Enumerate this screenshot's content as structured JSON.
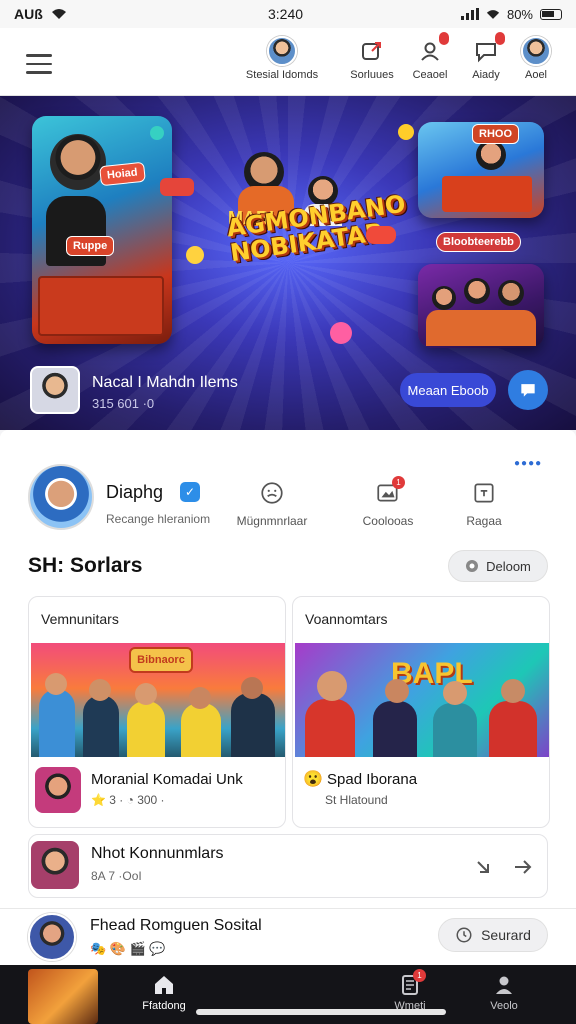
{
  "status_bar": {
    "carrier": "AUß",
    "time": "3:240",
    "battery": "80%"
  },
  "header": {
    "items": [
      {
        "label": "Stesial Idomds",
        "icon": "avatar"
      },
      {
        "label": "Sorluues",
        "icon": "share-icon"
      },
      {
        "label": "Ceaoel",
        "icon": "user-add-icon",
        "badge": ""
      },
      {
        "label": "Aiady",
        "icon": "message-icon",
        "badge": ""
      },
      {
        "label": "Aoel",
        "icon": "avatar"
      }
    ]
  },
  "banner": {
    "top_logo": "MARIA",
    "title": "AGMONBANO NOBIKATAR",
    "tag_left": "Hoiad",
    "tag_left2": "Ruppe",
    "tag_right_top": "RHOO",
    "tag_right_mid": "Bloobteerebb",
    "profile_name": "Nacal I Mahdn Ilems",
    "profile_sub": "315 601 ·0",
    "button_label": "Meaan Eboob"
  },
  "profile": {
    "name": "Diaphg",
    "subtitle": "Recange hleraniom",
    "stats": [
      {
        "label": "Mügnmnrlaar",
        "icon": "smile-icon"
      },
      {
        "label": "Coolooas",
        "icon": "image-icon",
        "badge": "1"
      },
      {
        "label": "Ragaa",
        "icon": "box-icon"
      }
    ]
  },
  "section": {
    "title": "SH: Sorlars",
    "button_label": "Deloom"
  },
  "cards": [
    {
      "header": "Vemnunitars",
      "thumb_label": "Bibnaorc",
      "title": "Moranial Komadai Unk",
      "meta": "⭐ 3 · ◔ 300 ·"
    },
    {
      "header": "Voannomtars",
      "thumb_label": "BAPL",
      "title": "Spad Iborana",
      "meta": "St Hlatound"
    }
  ],
  "list_item": {
    "title": "Nhot Konnunmlars",
    "subtitle": "8A 7 ·OoI"
  },
  "bottom_item": {
    "title": "Fhead Romguen Sosital",
    "button_label": "Seurard"
  },
  "bottom_nav": [
    {
      "label": "Ffatdong",
      "icon": "home-icon"
    },
    {
      "label": "Wmeti",
      "icon": "document-icon",
      "badge": "1"
    },
    {
      "label": "Veolo",
      "icon": "user-icon"
    }
  ]
}
